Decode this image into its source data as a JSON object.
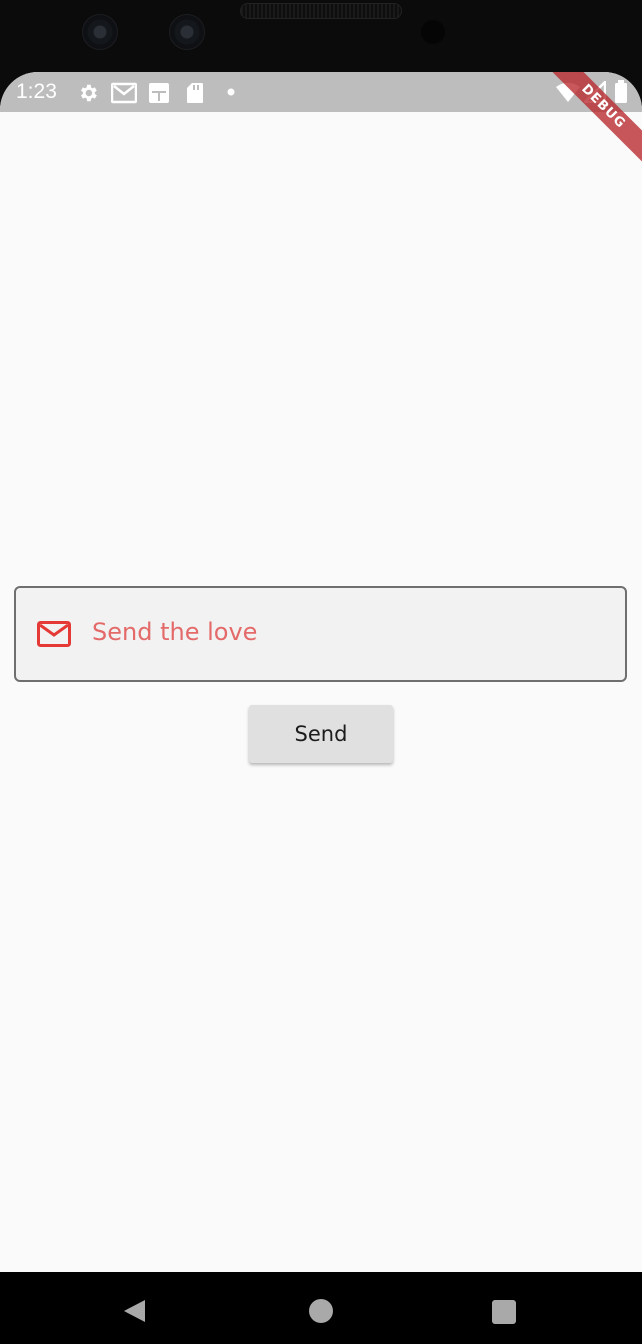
{
  "status_bar": {
    "time": "1:23",
    "icons": [
      "settings-icon",
      "gmail-icon",
      "sim-icon",
      "sd-card-icon",
      "dot-icon",
      "wifi-icon",
      "signal-icon",
      "battery-icon"
    ]
  },
  "debug_banner": {
    "label": "DEBUG"
  },
  "form": {
    "field_placeholder": "Send the love",
    "field_icon": "mail-icon",
    "send_label": "Send"
  },
  "colors": {
    "status_bar_bg": "#bdbdbd",
    "screen_bg": "#fafafa",
    "field_bg": "#f2f2f2",
    "field_border": "#6f6f6f",
    "accent_red": "#e53935",
    "placeholder_red": "#e46a6a",
    "button_bg": "#e0e0e0"
  },
  "nav_bar": {
    "buttons": [
      "back-icon",
      "home-icon",
      "recents-icon"
    ]
  }
}
